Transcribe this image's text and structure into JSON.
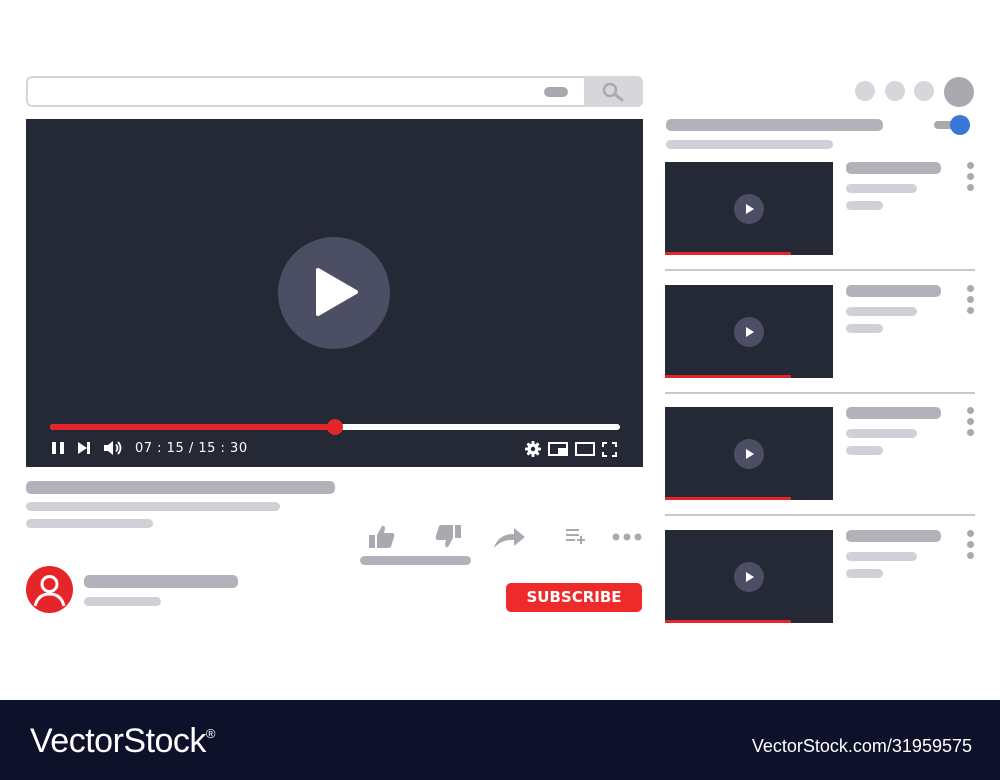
{
  "search": {
    "placeholder": ""
  },
  "player": {
    "time": "07 : 15 / 15 : 30",
    "progress": 0.5,
    "colors": {
      "background": "#252835",
      "progress": "#e5252a"
    }
  },
  "channel": {
    "subscribe_label": "SUBSCRIBE",
    "subscribe_color": "#ef2a2a"
  },
  "autoplay": {
    "on": true,
    "color": "#3a78d8"
  },
  "recommendations": [
    {
      "progress": 0.75
    },
    {
      "progress": 0.75
    },
    {
      "progress": 0.75
    },
    {
      "progress": 0.75
    }
  ],
  "icons": {
    "search": "search-icon",
    "pause": "pause-icon",
    "next": "next-icon",
    "volume": "volume-icon",
    "settings": "gear-icon",
    "miniplayer": "miniplayer-icon",
    "theater": "theater-icon",
    "fullscreen": "fullscreen-icon",
    "like": "thumbs-up-icon",
    "dislike": "thumbs-down-icon",
    "share": "share-icon",
    "save": "add-to-playlist-icon",
    "more": "more-icon"
  },
  "footer": {
    "brand": "VectorStock",
    "registered": "®",
    "image_id": "VectorStock.com/31959575"
  }
}
